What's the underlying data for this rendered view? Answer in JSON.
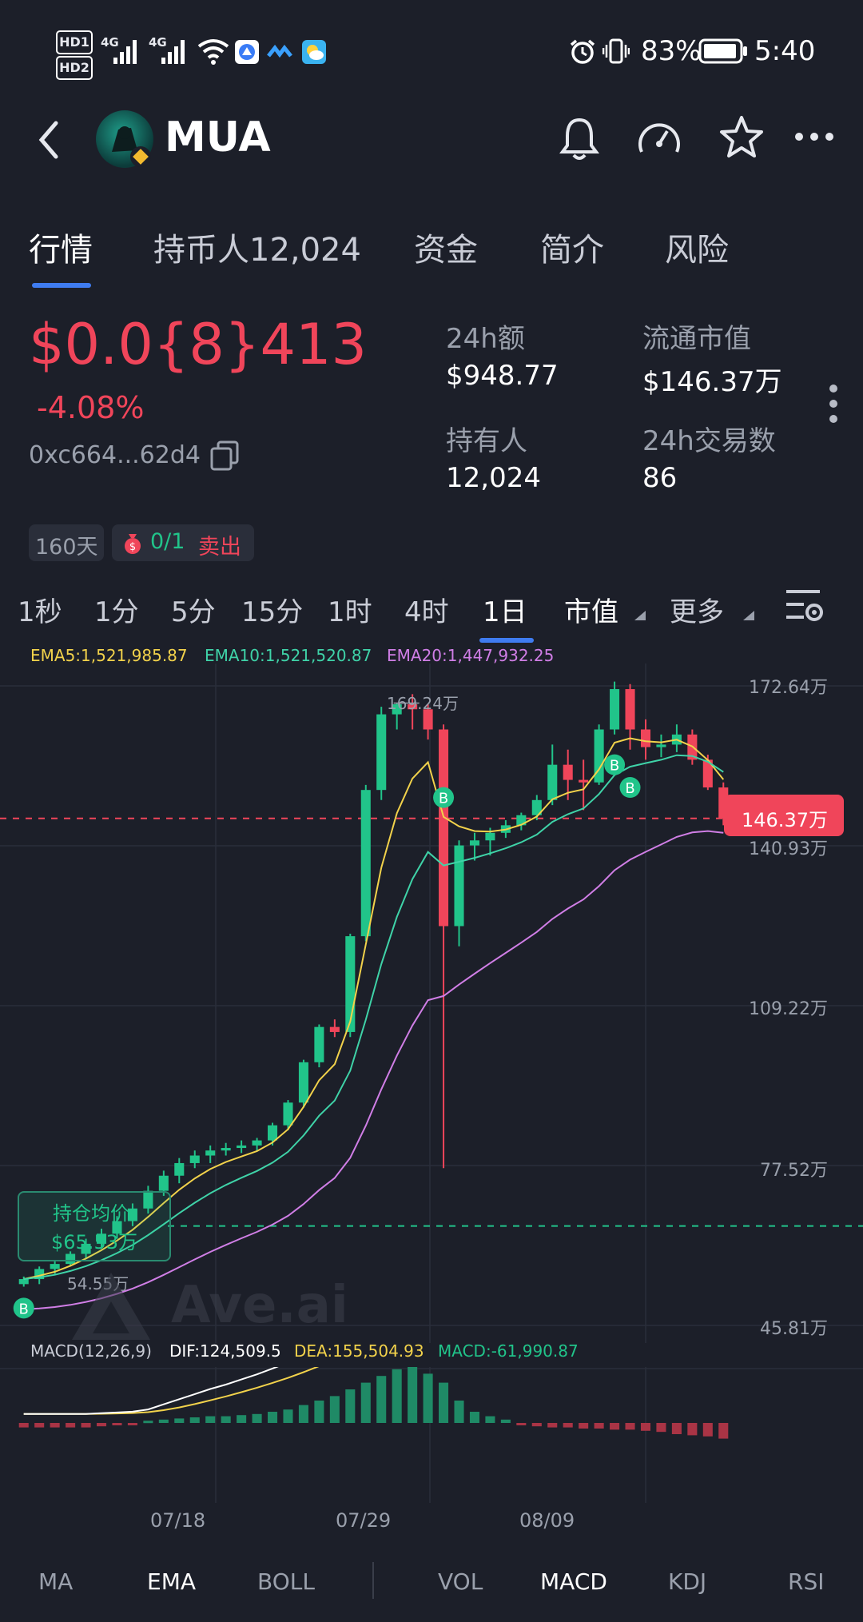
{
  "status_bar": {
    "hd1": "HD1",
    "hd2": "HD2",
    "net1": "4G",
    "net2": "4G",
    "battery": "83%",
    "time": "5:40"
  },
  "header": {
    "title": "MUA"
  },
  "tabs": [
    "行情",
    "持币人12,024",
    "资金",
    "简介",
    "风险"
  ],
  "price": {
    "value": "$0.0{8}413",
    "change": "-4.08%",
    "address": "0xc664...62d4"
  },
  "stats": {
    "vol_label": "24h额",
    "vol_value": "$948.77",
    "mcap_label": "流通市值",
    "mcap_value": "$146.37万",
    "holders_label": "持有人",
    "holders_value": "12,024",
    "tx_label": "24h交易数",
    "tx_value": "86"
  },
  "chips": {
    "days": "160天",
    "trades_a": "0/1",
    "trades_b": "卖出"
  },
  "intervals": [
    "1秒",
    "1分",
    "5分",
    "15分",
    "1时",
    "4时",
    "1日",
    "市值",
    "更多"
  ],
  "ema_legend": {
    "ema5": "EMA5:1,521,985.87",
    "ema10": "EMA10:1,521,520.87",
    "ema20": "EMA20:1,447,932.25"
  },
  "price_axis": [
    "172.64万",
    "140.93万",
    "109.22万",
    "77.52万",
    "45.81万"
  ],
  "current_tag": "146.37万",
  "high_label": "169.24万",
  "low_label": "54.55万",
  "avg_cost": {
    "label": "持仓均价",
    "value": "$65.53万"
  },
  "watermark": "Ave.ai",
  "macd_legend": {
    "name": "MACD(12,26,9)",
    "dif": "DIF:124,509.5",
    "dea": "DEA:155,504.93",
    "macd": "MACD:-61,990.87"
  },
  "dates": [
    "07/18",
    "07/29",
    "08/09"
  ],
  "indicators": [
    "MA",
    "EMA",
    "BOLL",
    "VOL",
    "MACD",
    "KDJ",
    "RSI"
  ],
  "colors": {
    "up": "#21c48a",
    "down": "#f0455a",
    "ema5": "#f2d24b",
    "ema10": "#3fd3a8",
    "ema20": "#d07ee6",
    "accent": "#3f7cf0"
  },
  "chart_data": {
    "type": "candlestick",
    "unit": "万",
    "ylim": [
      45.81,
      172.64
    ],
    "candles": [
      {
        "o": 54.0,
        "h": 55.5,
        "l": 53.5,
        "c": 55.0
      },
      {
        "o": 55.0,
        "h": 57.5,
        "l": 54.0,
        "c": 57.0
      },
      {
        "o": 57.0,
        "h": 58.5,
        "l": 56.0,
        "c": 58.0
      },
      {
        "o": 58.0,
        "h": 60.5,
        "l": 57.5,
        "c": 60.0
      },
      {
        "o": 60.0,
        "h": 63.0,
        "l": 59.0,
        "c": 62.0
      },
      {
        "o": 62.0,
        "h": 65.0,
        "l": 61.0,
        "c": 64.0
      },
      {
        "o": 64.0,
        "h": 67.5,
        "l": 63.0,
        "c": 66.5
      },
      {
        "o": 66.5,
        "h": 70.0,
        "l": 65.5,
        "c": 69.0
      },
      {
        "o": 69.0,
        "h": 73.5,
        "l": 68.0,
        "c": 72.5
      },
      {
        "o": 72.5,
        "h": 76.5,
        "l": 71.5,
        "c": 75.5
      },
      {
        "o": 75.5,
        "h": 79.0,
        "l": 74.0,
        "c": 78.0
      },
      {
        "o": 78.0,
        "h": 80.5,
        "l": 77.0,
        "c": 79.5
      },
      {
        "o": 79.5,
        "h": 81.5,
        "l": 78.0,
        "c": 80.5
      },
      {
        "o": 80.5,
        "h": 82.0,
        "l": 79.5,
        "c": 81.0
      },
      {
        "o": 81.0,
        "h": 82.5,
        "l": 80.0,
        "c": 81.5
      },
      {
        "o": 81.5,
        "h": 83.0,
        "l": 80.5,
        "c": 82.5
      },
      {
        "o": 82.5,
        "h": 86.0,
        "l": 81.5,
        "c": 85.5
      },
      {
        "o": 85.5,
        "h": 90.5,
        "l": 84.5,
        "c": 90.0
      },
      {
        "o": 90.0,
        "h": 98.5,
        "l": 89.0,
        "c": 98.0
      },
      {
        "o": 98.0,
        "h": 105.5,
        "l": 97.0,
        "c": 105.0
      },
      {
        "o": 105.0,
        "h": 106.5,
        "l": 103.0,
        "c": 104.0
      },
      {
        "o": 104.0,
        "h": 123.5,
        "l": 103.0,
        "c": 123.0
      },
      {
        "o": 123.0,
        "h": 153.0,
        "l": 122.0,
        "c": 152.0
      },
      {
        "o": 152.0,
        "h": 168.5,
        "l": 150.0,
        "c": 167.0
      },
      {
        "o": 167.0,
        "h": 169.24,
        "l": 164.0,
        "c": 169.0
      },
      {
        "o": 169.0,
        "h": 171.0,
        "l": 164.0,
        "c": 168.0
      },
      {
        "o": 168.0,
        "h": 169.0,
        "l": 162.0,
        "c": 164.0
      },
      {
        "o": 164.0,
        "h": 165.0,
        "l": 77.0,
        "c": 125.0
      },
      {
        "o": 125.0,
        "h": 142.0,
        "l": 121.0,
        "c": 141.0
      },
      {
        "o": 141.0,
        "h": 143.5,
        "l": 138.0,
        "c": 142.0
      },
      {
        "o": 142.0,
        "h": 144.5,
        "l": 139.0,
        "c": 143.5
      },
      {
        "o": 143.5,
        "h": 146.0,
        "l": 142.5,
        "c": 145.0
      },
      {
        "o": 145.0,
        "h": 147.5,
        "l": 144.0,
        "c": 147.0
      },
      {
        "o": 147.0,
        "h": 151.0,
        "l": 146.0,
        "c": 150.0
      },
      {
        "o": 150.0,
        "h": 161.0,
        "l": 149.0,
        "c": 157.0
      },
      {
        "o": 157.0,
        "h": 160.0,
        "l": 150.0,
        "c": 154.0
      },
      {
        "o": 154.0,
        "h": 158.0,
        "l": 148.0,
        "c": 153.5
      },
      {
        "o": 153.5,
        "h": 165.0,
        "l": 153.0,
        "c": 164.0
      },
      {
        "o": 164.0,
        "h": 173.5,
        "l": 163.0,
        "c": 172.0
      },
      {
        "o": 172.0,
        "h": 173.0,
        "l": 160.0,
        "c": 164.0
      },
      {
        "o": 164.0,
        "h": 166.0,
        "l": 158.0,
        "c": 160.5
      },
      {
        "o": 160.5,
        "h": 163.0,
        "l": 158.5,
        "c": 161.0
      },
      {
        "o": 161.0,
        "h": 165.0,
        "l": 159.5,
        "c": 163.0
      },
      {
        "o": 163.0,
        "h": 164.0,
        "l": 157.0,
        "c": 158.0
      },
      {
        "o": 158.0,
        "h": 159.0,
        "l": 152.0,
        "c": 152.5
      },
      {
        "o": 152.5,
        "h": 153.5,
        "l": 145.0,
        "c": 146.37
      }
    ],
    "macd_hist": [
      -2,
      -2,
      -2,
      -2,
      -2,
      -1.5,
      -1,
      -0.5,
      1,
      1.5,
      2,
      2.5,
      3,
      3,
      3.5,
      4,
      5,
      6,
      8,
      10,
      12,
      15,
      18,
      21,
      24,
      26,
      22,
      18,
      10,
      5,
      3,
      1.5,
      -1,
      -1.5,
      -2,
      -2,
      -2.5,
      -2.5,
      -3,
      -3,
      -3.5,
      -4,
      -5,
      -5.5,
      -6,
      -7
    ]
  }
}
